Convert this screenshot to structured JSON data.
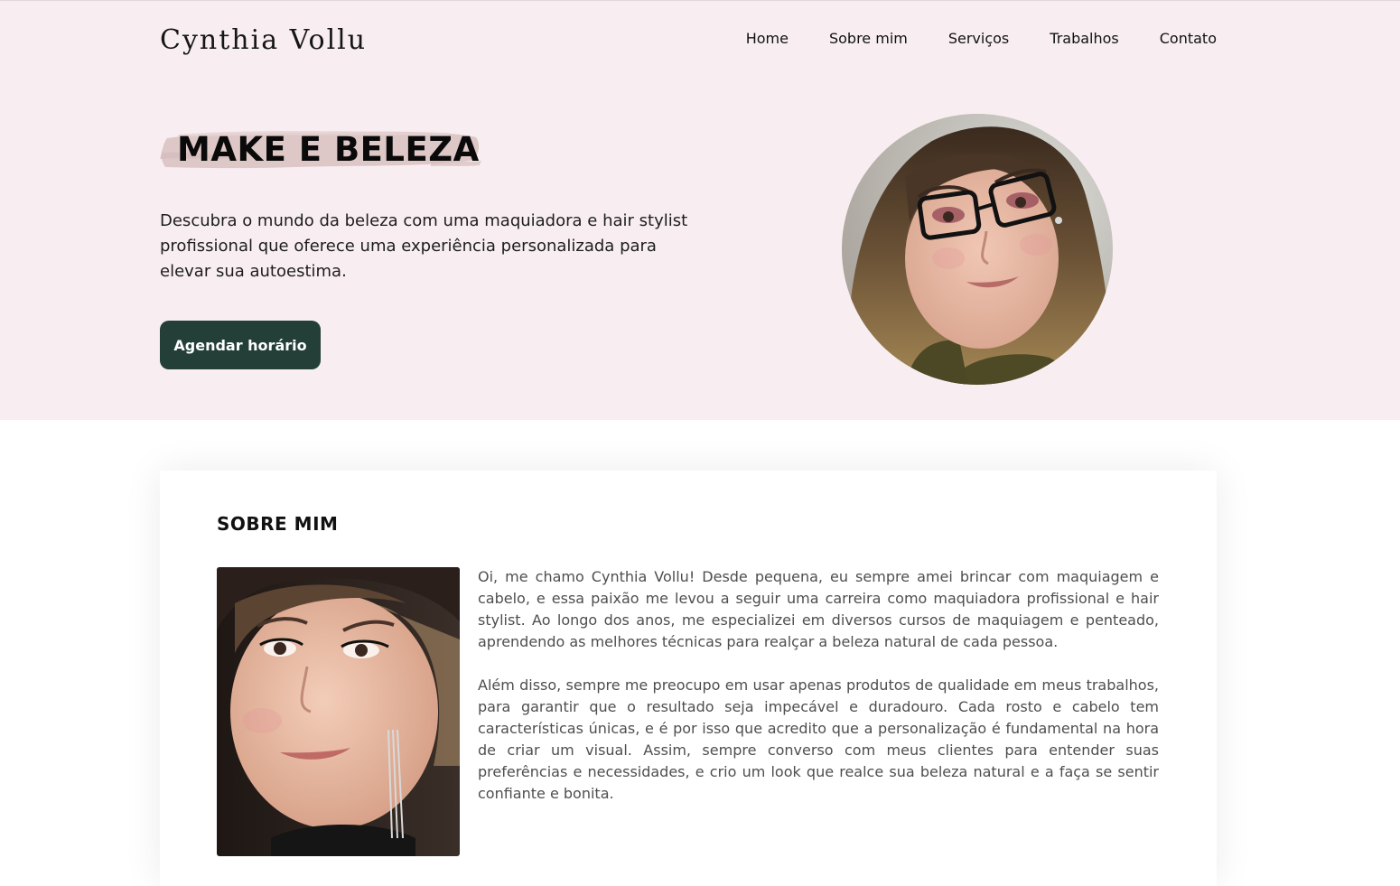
{
  "brand": {
    "name": "Cynthia Vollu"
  },
  "nav": {
    "items": [
      {
        "label": "Home"
      },
      {
        "label": "Sobre mim"
      },
      {
        "label": "Serviços"
      },
      {
        "label": "Trabalhos"
      },
      {
        "label": "Contato"
      }
    ]
  },
  "hero": {
    "title": "MAKE E BELEZA",
    "description": "Descubra o mundo da beleza com uma maquiadora e hair stylist profissional que oferece uma experiência personalizada para elevar sua autoestima.",
    "cta_label": "Agendar horário"
  },
  "about": {
    "title": "SOBRE MIM",
    "paragraphs": [
      "Oi, me chamo Cynthia Vollu! Desde pequena, eu sempre amei brincar com maquiagem e cabelo, e essa paixão me levou a seguir uma carreira como maquiadora profissional e hair stylist. Ao longo dos anos, me especializei em diversos cursos de maquiagem e penteado, aprendendo as melhores técnicas para realçar a beleza natural de cada pessoa.",
      "Além disso, sempre me preocupo em usar apenas produtos de qualidade em meus trabalhos, para garantir que o resultado seja impecável e duradouro. Cada rosto e cabelo tem características únicas, e é por isso que acredito que a personalização é fundamental na hora de criar um visual. Assim, sempre converso com meus clientes para entender suas preferências e necessidades, e crio um look que realce sua beleza natural e a faça se sentir confiante e bonita."
    ]
  },
  "colors": {
    "hero_background": "#f8eef2",
    "cta_background": "#233f38",
    "brush_accent": "#dcc4c4"
  }
}
